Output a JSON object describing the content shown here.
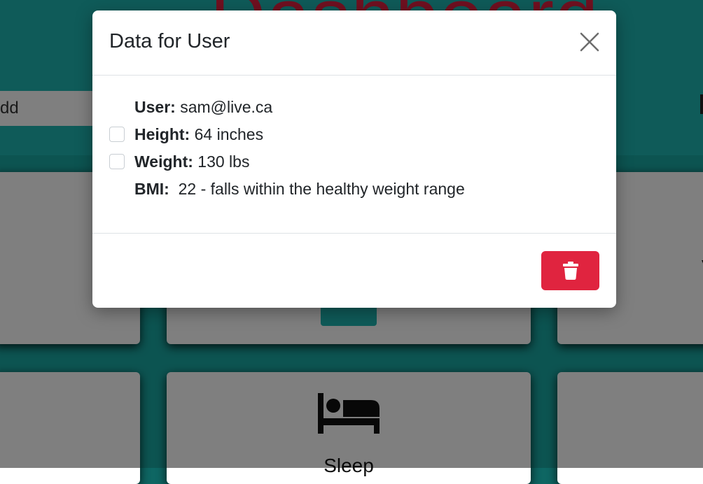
{
  "background": {
    "title_fragment": "Dashboard",
    "input_fragment": "dd",
    "card_label": "Sleep"
  },
  "modal": {
    "title": "Data for User",
    "fields": [
      {
        "label": "User:",
        "value": " sam@live.ca",
        "checkbox": false
      },
      {
        "label": "Height:",
        "value": " 64 inches",
        "checkbox": true
      },
      {
        "label": "Weight:",
        "value": " 130 lbs",
        "checkbox": true
      },
      {
        "label": "BMI:",
        "value": "  22 - falls within the healthy weight range",
        "checkbox": false
      }
    ]
  },
  "icons": {
    "close": "close-icon",
    "delete": "trash-icon",
    "bed": "bed-icon",
    "add": "plus-icon"
  },
  "colors": {
    "teal": "#1fb7b2",
    "danger": "#e0243f",
    "title_red": "#e02040"
  }
}
